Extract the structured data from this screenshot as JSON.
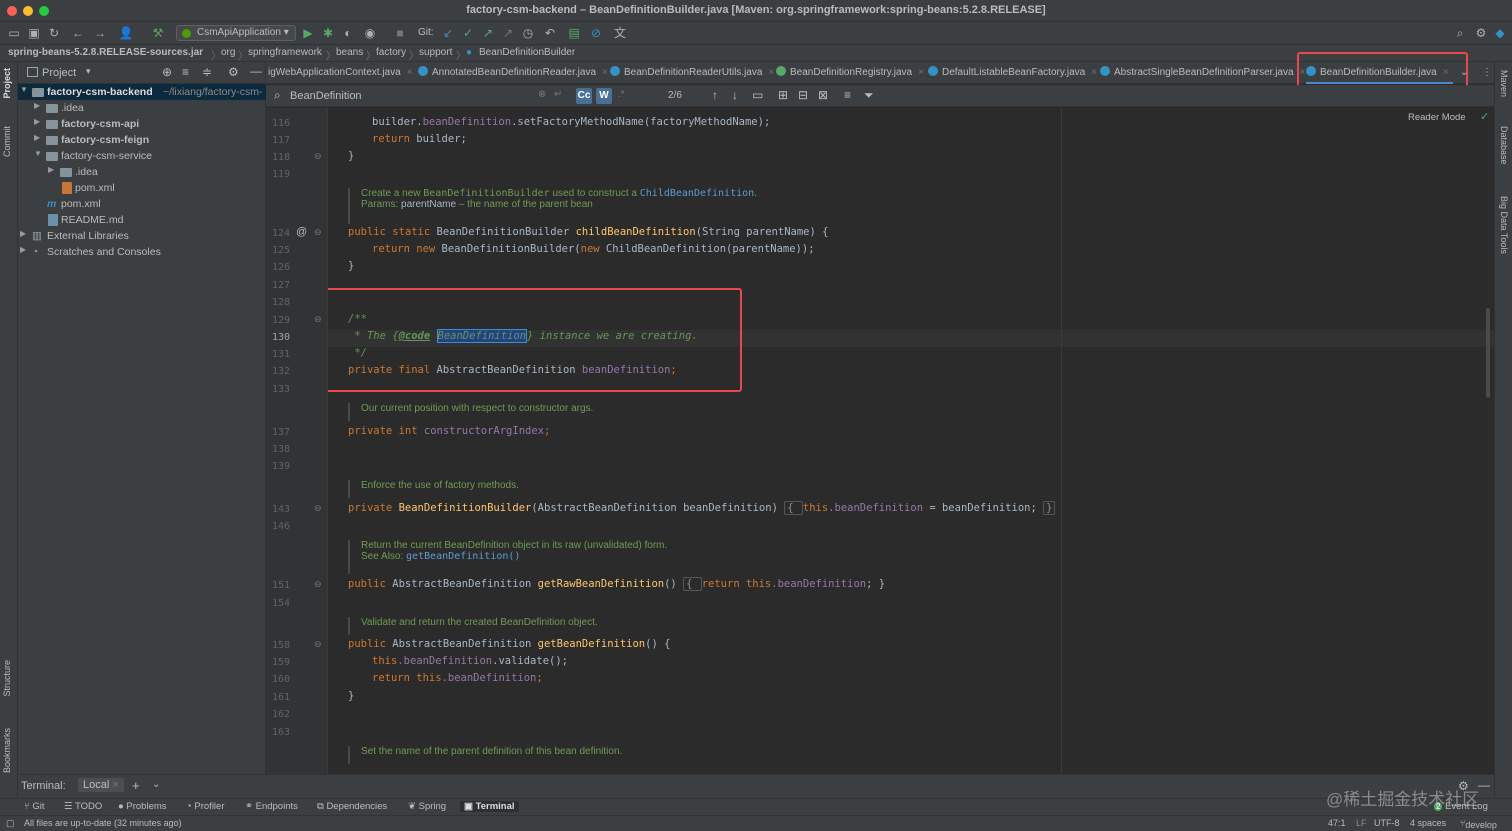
{
  "window": {
    "title": "factory-csm-backend – BeanDefinitionBuilder.java [Maven: org.springframework:spring-beans:5.2.8.RELEASE]"
  },
  "toolbar": {
    "run_config": "CsmApiApplication",
    "git_label": "Git:"
  },
  "breadcrumb": [
    "spring-beans-5.2.8.RELEASE-sources.jar",
    "org",
    "springframework",
    "beans",
    "factory",
    "support",
    "BeanDefinitionBuilder"
  ],
  "left_strip": {
    "project": "Project",
    "commit": "Commit",
    "structure": "Structure",
    "bookmarks": "Bookmarks"
  },
  "right_strip": {
    "maven": "Maven",
    "database": "Database",
    "bigdata": "Big Data Tools"
  },
  "project_panel": {
    "title": "Project",
    "tree": [
      {
        "label": "factory-csm-backend",
        "path": "~/lixiang/factory-csm-",
        "bold": true
      },
      {
        "label": ".idea"
      },
      {
        "label": "factory-csm-api",
        "bold": true
      },
      {
        "label": "factory-csm-feign",
        "bold": true
      },
      {
        "label": "factory-csm-service"
      },
      {
        "label": ".idea"
      },
      {
        "label": "pom.xml"
      },
      {
        "label": "pom.xml"
      },
      {
        "label": "README.md"
      },
      {
        "label": "External Libraries"
      },
      {
        "label": "Scratches and Consoles"
      }
    ]
  },
  "tabs": [
    {
      "label": "igWebApplicationContext.java"
    },
    {
      "label": "AnnotatedBeanDefinitionReader.java"
    },
    {
      "label": "BeanDefinitionReaderUtils.java"
    },
    {
      "label": "BeanDefinitionRegistry.java"
    },
    {
      "label": "DefaultListableBeanFactory.java"
    },
    {
      "label": "AbstractSingleBeanDefinitionParser.java"
    },
    {
      "label": "BeanDefinitionBuilder.java"
    }
  ],
  "search": {
    "query": "BeanDefinition",
    "match_case": "Cc",
    "words": "W",
    "count": "2/6"
  },
  "editor": {
    "reader_mode": "Reader Mode",
    "line_numbers": [
      "116",
      "117",
      "118",
      "119",
      "124",
      "125",
      "126",
      "127",
      "128",
      "129",
      "130",
      "131",
      "132",
      "133",
      "137",
      "138",
      "139",
      "143",
      "146",
      "151",
      "154",
      "158",
      "159",
      "160",
      "161",
      "162",
      "163"
    ],
    "code": {
      "l116a": "builder.",
      "l116b": "beanDefinition",
      "l116c": ".setFactoryMethodName(factoryMethodName);",
      "l117a": "return",
      "l117b": " builder;",
      "l118": "}",
      "doc1a": "Create a new ",
      "doc1b": "BeanDefinitionBuilder",
      "doc1c": " used to construct a ",
      "doc1d": "ChildBeanDefinition",
      "doc1e": ".",
      "doc1f": "Params: ",
      "doc1g": "parentName",
      "doc1h": " – the name of the parent bean",
      "l124a": "public static",
      "l124b": " BeanDefinitionBuilder ",
      "l124c": "childBeanDefinition",
      "l124d": "(String parentName) {",
      "l125a": "return new",
      "l125b": " BeanDefinitionBuilder(",
      "l125c": "new",
      "l125d": " ChildBeanDefinition(parentName));",
      "l126": "}",
      "l129": "/**",
      "l130a": " * The {",
      "l130b": "@code",
      "l130c": "BeanDefinition",
      "l130d": "} instance we are creating.",
      "l131": " */",
      "l132a": "private final",
      "l132b": " AbstractBeanDefinition ",
      "l132c": "beanDefinition",
      "l132d": ";",
      "doc2": "Our current position with respect to constructor args.",
      "l137a": "private int",
      "l137b": " constructorArgIndex",
      "l137c": ";",
      "doc3": "Enforce the use of factory methods.",
      "l143a": "private",
      "l143b": "BeanDefinitionBuilder",
      "l143c": "(AbstractBeanDefinition beanDefinition) ",
      "l143d": "{ ",
      "l143e": "this",
      "l143f": ".beanDefinition",
      "l143g": " = beanDefinition; ",
      "l143h": "}",
      "doc4": "Return the current BeanDefinition object in its raw (unvalidated) form.",
      "doc4b": "See Also: ",
      "doc4c": "getBeanDefinition()",
      "l151a": "public",
      "l151b": " AbstractBeanDefinition ",
      "l151c": "getRawBeanDefinition",
      "l151d": "() ",
      "l151e": "{ ",
      "l151f": "return this",
      "l151g": ".beanDefinition",
      "l151h": "; }",
      "doc5": "Validate and return the created BeanDefinition object.",
      "l158a": "public",
      "l158b": " AbstractBeanDefinition ",
      "l158c": "getBeanDefinition",
      "l158d": "() {",
      "l159a": "this",
      "l159b": ".beanDefinition",
      "l159c": ".validate();",
      "l160a": "return this",
      "l160b": ".beanDefinition",
      "l160c": ";",
      "l161": "}",
      "doc6": "Set the name of the parent definition of this bean definition."
    }
  },
  "terminal": {
    "label": "Terminal:",
    "tab": "Local"
  },
  "tool_windows": [
    "Git",
    "TODO",
    "Problems",
    "Profiler",
    "Endpoints",
    "Dependencies",
    "Spring",
    "Terminal"
  ],
  "status": {
    "message": "All files are up-to-date (32 minutes ago)",
    "position": "47:1",
    "line_sep": "LF",
    "encoding": "UTF-8",
    "indent": "4 spaces",
    "branch": "develop",
    "event_log": "Event Log",
    "event_count": "2"
  },
  "watermark": "@稀土掘金技术社区",
  "colors": {
    "bg": "#2b2b2b",
    "panel": "#3c3f41",
    "keyword": "#cc7832",
    "function": "#ffc66d",
    "field": "#9876aa",
    "comment": "#629755",
    "highlight": "#e5484d"
  }
}
